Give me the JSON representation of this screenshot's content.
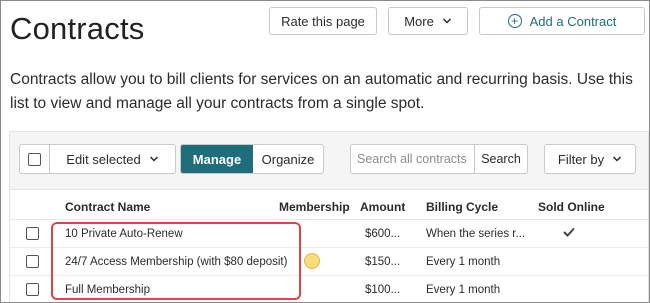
{
  "header": {
    "title": "Contracts",
    "rate_label": "Rate this page",
    "more_label": "More",
    "add_label": "Add a Contract"
  },
  "description": "Contracts allow you to bill clients for services on an automatic and recurring basis. Use this list to view and manage all your contracts from a single spot.",
  "toolbar": {
    "edit_selected_label": "Edit selected",
    "manage_label": "Manage",
    "organize_label": "Organize",
    "search_placeholder": "Search all contracts",
    "search_button_label": "Search",
    "filter_label": "Filter by"
  },
  "table": {
    "columns": [
      "Contract Name",
      "Membership",
      "Amount",
      "Billing Cycle",
      "Sold Online"
    ],
    "rows": [
      {
        "name": "10 Private Auto-Renew",
        "membership_icon": "",
        "amount": "$600...",
        "billing_cycle": "When the series r...",
        "sold_online": "check-icon"
      },
      {
        "name": "24/7 Access Membership (with $80 deposit)",
        "membership_icon": "membership-coin-icon",
        "amount": "$150...",
        "billing_cycle": "Every 1 month",
        "sold_online": ""
      },
      {
        "name": "Full Membership",
        "membership_icon": "",
        "amount": "$100...",
        "billing_cycle": "Every 1 month",
        "sold_online": ""
      }
    ]
  },
  "colors": {
    "accent": "#1f6d7a",
    "highlight_border": "#e0424b",
    "coin": "#f6de7e"
  }
}
